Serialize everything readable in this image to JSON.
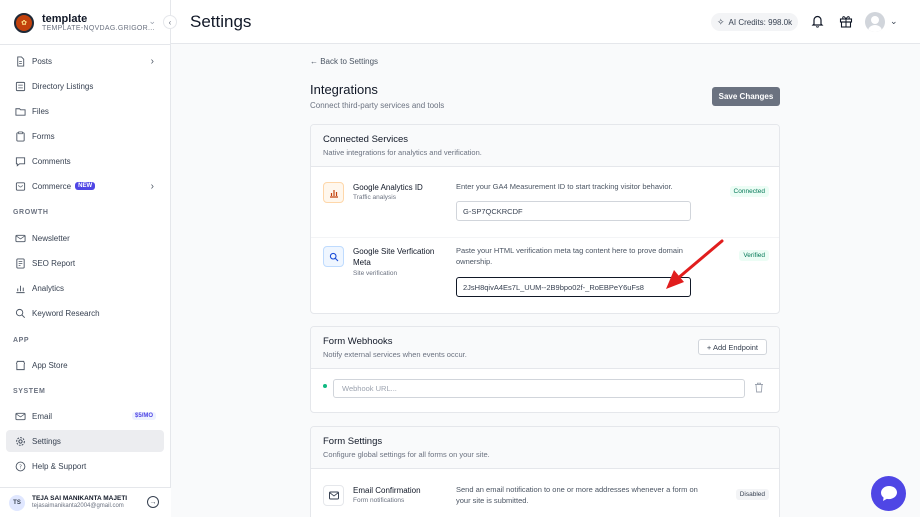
{
  "workspace": {
    "name": "template",
    "subtitle": "TEMPLATE-NQVDAG.GRIGOR..."
  },
  "sidebar": {
    "items": [
      {
        "label": "Posts"
      },
      {
        "label": "Directory Listings"
      },
      {
        "label": "Files"
      },
      {
        "label": "Forms"
      },
      {
        "label": "Comments"
      },
      {
        "label": "Commerce",
        "badge": "NEW"
      }
    ],
    "growth_label": "GROWTH",
    "growth": [
      {
        "label": "Newsletter"
      },
      {
        "label": "SEO Report"
      },
      {
        "label": "Analytics"
      },
      {
        "label": "Keyword Research"
      }
    ],
    "app_label": "APP",
    "app": [
      {
        "label": "App Store"
      }
    ],
    "system_label": "SYSTEM",
    "system": [
      {
        "label": "Email",
        "badge": "$5/MO"
      },
      {
        "label": "Settings"
      },
      {
        "label": "Help & Support"
      }
    ]
  },
  "user": {
    "initials": "TS",
    "name": "TEJA SAI MANIKANTA MAJETI",
    "email": "tejasaimanikanta2004@gmail.com"
  },
  "header": {
    "title": "Settings",
    "credits": "AI Credits: 998.0k"
  },
  "main": {
    "back": "← Back to Settings",
    "title": "Integrations",
    "subtitle": "Connect third-party services and tools",
    "save": "Save Changes",
    "connected": {
      "title": "Connected Services",
      "subtitle": "Native integrations for analytics and verification.",
      "services": [
        {
          "name": "Google Analytics ID",
          "meta": "Traffic analysis",
          "desc": "Enter your GA4 Measurement ID to start tracking visitor behavior.",
          "value": "G-SP7QCKRCDF",
          "status": "Connected"
        },
        {
          "name": "Google Site Verfication Meta",
          "meta": "Site verification",
          "desc": "Paste your HTML verification meta tag content here to prove domain ownership.",
          "value": "2JsH8qivA4Es7L_UUM--2B9bpo02f-_RoEBPeY6uFs8",
          "status": "Verified"
        }
      ]
    },
    "webhooks": {
      "title": "Form Webhooks",
      "subtitle": "Notify external services when events occur.",
      "add": "+ Add Endpoint",
      "placeholder": "Webhook URL..."
    },
    "form_settings": {
      "title": "Form Settings",
      "subtitle": "Configure global settings for all forms on your site.",
      "email": {
        "name": "Email Confirmation",
        "meta": "Form notifications",
        "desc": "Send an email notification to one or more addresses whenever a form on your site is submitted.",
        "status": "Disabled"
      }
    }
  },
  "colors": {
    "accent": "#4f46e5",
    "annotation_arrow": "#e11d1d"
  }
}
